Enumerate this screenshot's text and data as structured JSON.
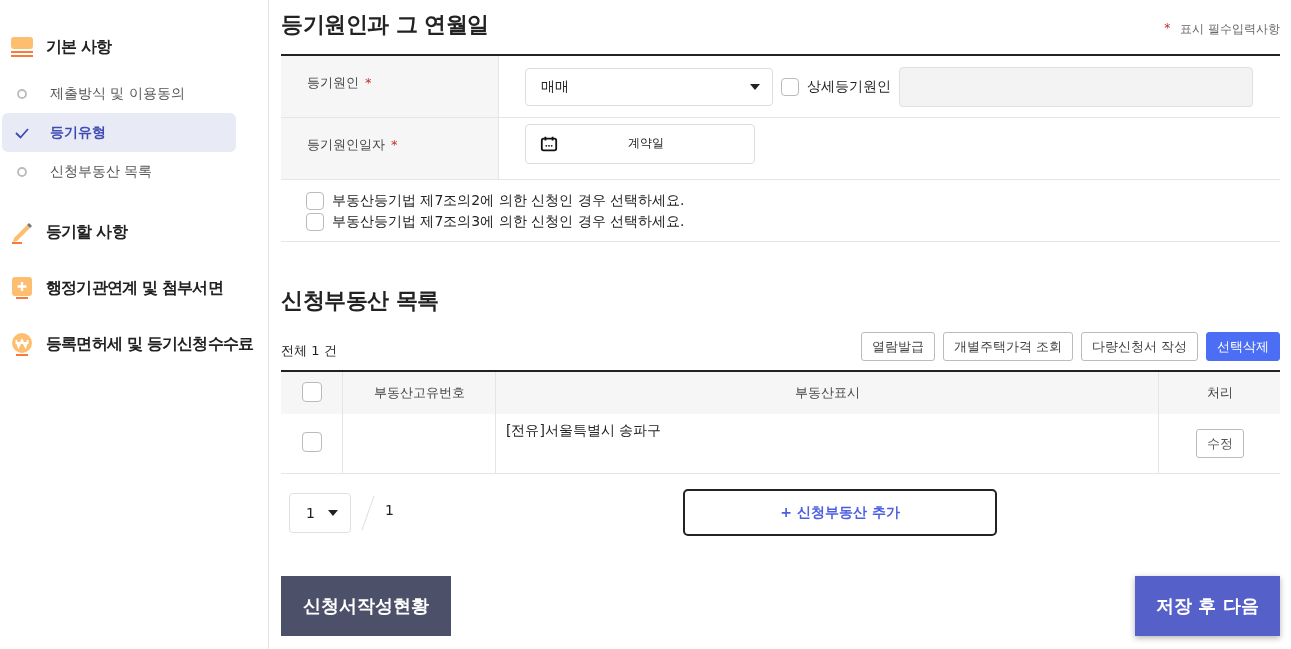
{
  "sidebar": {
    "sections": [
      {
        "label": "기본 사항",
        "kind": "stack",
        "items": [
          {
            "label": "제출방식 및 이용동의",
            "selected": false
          },
          {
            "label": "등기유형",
            "selected": true
          },
          {
            "label": "신청부동산 목록",
            "selected": false
          }
        ]
      },
      {
        "label": "등기할 사항",
        "kind": "pencil"
      },
      {
        "label": "행정기관연계 및 첨부서면",
        "kind": "plus"
      },
      {
        "label": "등록면허세 및 등기신청수수료",
        "kind": "won"
      }
    ]
  },
  "cause_section": {
    "title": "등기원인과 그 연월일",
    "required_mark": "*",
    "required_note": "표시 필수입력사항",
    "cause": {
      "label": "등기원인",
      "required_mark": "*",
      "value": "매매",
      "detail_checkbox": {
        "label": "상세등기원인",
        "checked": false
      }
    },
    "date": {
      "label": "등기원인일자",
      "required_mark": "*",
      "value": "계약일"
    },
    "options": [
      {
        "label": "부동산등기법 제7조의2에 의한 신청인 경우 선택하세요.",
        "checked": false
      },
      {
        "label": "부동산등기법 제7조의3에 의한 신청인 경우 선택하세요.",
        "checked": false
      }
    ]
  },
  "property_section": {
    "title": "신청부동산 목록",
    "total": "전체 1 건",
    "buttons": [
      {
        "label": "열람발급",
        "primary": false
      },
      {
        "label": "개별주택가격 조회",
        "primary": false
      },
      {
        "label": "다량신청서 작성",
        "primary": false
      },
      {
        "label": "선택삭제",
        "primary": true
      }
    ],
    "columns": [
      "부동산고유번호",
      "부동산표시",
      "처리"
    ],
    "header_checked": false,
    "rows": [
      {
        "checked": false,
        "address": "[전유]서울특별시 송파구",
        "action": "수정"
      }
    ],
    "page": "1",
    "page_total": "1",
    "add_button": "+ 신청부동산 추가"
  },
  "footer": {
    "status_button": "신청서작성현황",
    "next_button": "저장 후 다음"
  }
}
